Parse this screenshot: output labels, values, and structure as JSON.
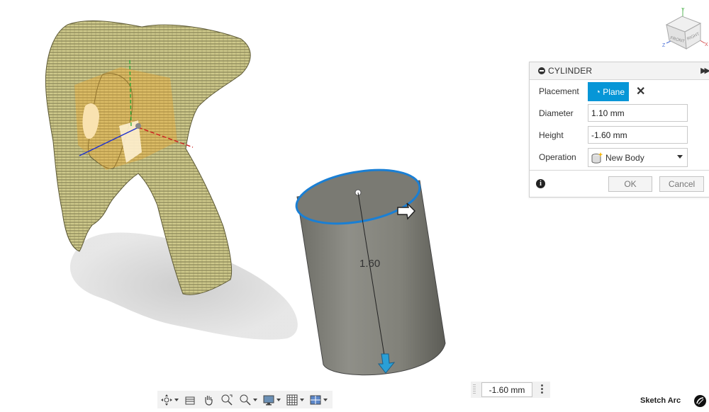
{
  "dialog": {
    "title": "CYLINDER",
    "placement_label": "Placement",
    "placement_value": "Plane",
    "diameter_label": "Diameter",
    "diameter_value": "1.10 mm",
    "height_label": "Height",
    "height_value": "-1.60 mm",
    "operation_label": "Operation",
    "operation_value": "New Body",
    "ok_label": "OK",
    "cancel_label": "Cancel"
  },
  "viewport": {
    "dimension_label": "1.60",
    "value_input": "-1.60 mm",
    "viewcube_faces": [
      "TOP",
      "FRONT",
      "RIGHT"
    ],
    "axes": [
      "Y",
      "Z",
      "X"
    ]
  },
  "status": {
    "sketch_mode": "Sketch Arc"
  },
  "toolbar": {
    "items": [
      "orbit-icon",
      "look-at-icon",
      "pan-icon",
      "zoom-window-icon",
      "zoom-fit-icon",
      "display-settings-icon",
      "grid-icon",
      "viewports-icon"
    ]
  },
  "colors": {
    "accent": "#0696d7",
    "selection_edge": "#1a7fd4",
    "body": "#8a8a82"
  }
}
